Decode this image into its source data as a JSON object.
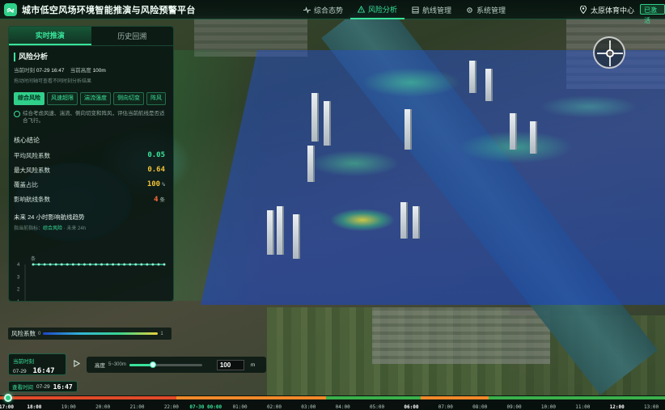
{
  "header": {
    "title": "城市低空风场环境智能推演与风险预警平台",
    "nav": [
      {
        "label": "综合态势",
        "icon": "pulse-icon",
        "active": false
      },
      {
        "label": "风险分析",
        "icon": "warning-icon",
        "active": true
      },
      {
        "label": "航线管理",
        "icon": "route-icon",
        "active": false
      },
      {
        "label": "系统管理",
        "icon": "gear-icon",
        "active": false
      }
    ],
    "location": "太原体育中心",
    "status": "已激活"
  },
  "panel": {
    "tabs": [
      "实时推演",
      "历史回溯"
    ],
    "active_tab": "实时推演",
    "section_title": "风险分析",
    "time_label": "当前时刻",
    "time_value": "07-29 16:47",
    "alt_label": "当前高度",
    "alt_value": "100m",
    "hint": "拖动时间轴可查看不同时刻分析结果",
    "chips": [
      "综合风险",
      "风速超限",
      "湍流强度",
      "侧向切变",
      "阵风"
    ],
    "active_chip": "综合风险",
    "description": "综合考虑风速、湍流、侧向切变和阵风，评估当前航线是否适合飞行。",
    "conclusion_title": "核心结论",
    "metrics": [
      {
        "label": "平均风险系数",
        "value": "0.05",
        "unit": "",
        "color": "#3be49b"
      },
      {
        "label": "最大风险系数",
        "value": "0.64",
        "unit": "",
        "color": "#f0c23a"
      },
      {
        "label": "覆盖占比",
        "value": "100",
        "unit": "%",
        "color": "#f0c23a"
      },
      {
        "label": "影响航线条数",
        "value": "4",
        "unit": "条",
        "color": "#ff6a3a"
      }
    ],
    "trend_title": "未来 24 小时影响航线趋势",
    "trend_sub_label": "指当前指标：",
    "trend_sub_metric": "综合风险",
    "trend_sub_range": "· 未来 24h",
    "trend_unit": "条"
  },
  "chart_data": {
    "type": "line",
    "title": "未来 24 小时影响航线趋势",
    "ylabel": "条",
    "yticks": [
      "4",
      "3",
      "2",
      "1"
    ],
    "ylim": [
      0,
      4
    ],
    "points": 24,
    "values": [
      4,
      4,
      4,
      4,
      4,
      4,
      4,
      4,
      4,
      4,
      4,
      4,
      4,
      4,
      4,
      4,
      4,
      4,
      4,
      4,
      4,
      4,
      4,
      4
    ]
  },
  "legend": {
    "label": "风险系数",
    "min": "0",
    "max": "1"
  },
  "time": {
    "current_label": "当前时刻",
    "current_date": "07-29",
    "current_time": "16:47",
    "view_label": "查看时间",
    "view_date": "07-29",
    "view_time": "16:47"
  },
  "altitude": {
    "label": "高度",
    "range": "5~300m",
    "value": "100",
    "unit": "m",
    "fraction": 0.32
  },
  "timeline": {
    "ticks": [
      {
        "label": "17:00",
        "style": "major"
      },
      {
        "label": "18:00",
        "style": "major"
      },
      {
        "label": "19:00",
        "style": "normal"
      },
      {
        "label": "20:00",
        "style": "normal"
      },
      {
        "label": "21:00",
        "style": "normal"
      },
      {
        "label": "22:00",
        "style": "normal"
      },
      {
        "label": "07-30 00:00",
        "style": "day"
      },
      {
        "label": "01:00",
        "style": "normal"
      },
      {
        "label": "02:00",
        "style": "normal"
      },
      {
        "label": "03:00",
        "style": "normal"
      },
      {
        "label": "04:00",
        "style": "normal"
      },
      {
        "label": "05:00",
        "style": "normal"
      },
      {
        "label": "06:00",
        "style": "major"
      },
      {
        "label": "07:00",
        "style": "normal"
      },
      {
        "label": "08:00",
        "style": "normal"
      },
      {
        "label": "09:00",
        "style": "normal"
      },
      {
        "label": "10:00",
        "style": "normal"
      },
      {
        "label": "11:00",
        "style": "normal"
      },
      {
        "label": "12:00",
        "style": "major"
      },
      {
        "label": "13:00",
        "style": "normal"
      }
    ],
    "segments": [
      {
        "color": "#e14b2a",
        "hours": 6.5
      },
      {
        "color": "#f08a2a",
        "hours": 5.5
      },
      {
        "color": "#3ab04a",
        "hours": 3.5
      },
      {
        "color": "#f08a2a",
        "hours": 2.5
      },
      {
        "color": "#3ab04a",
        "hours": 6.5
      }
    ]
  }
}
